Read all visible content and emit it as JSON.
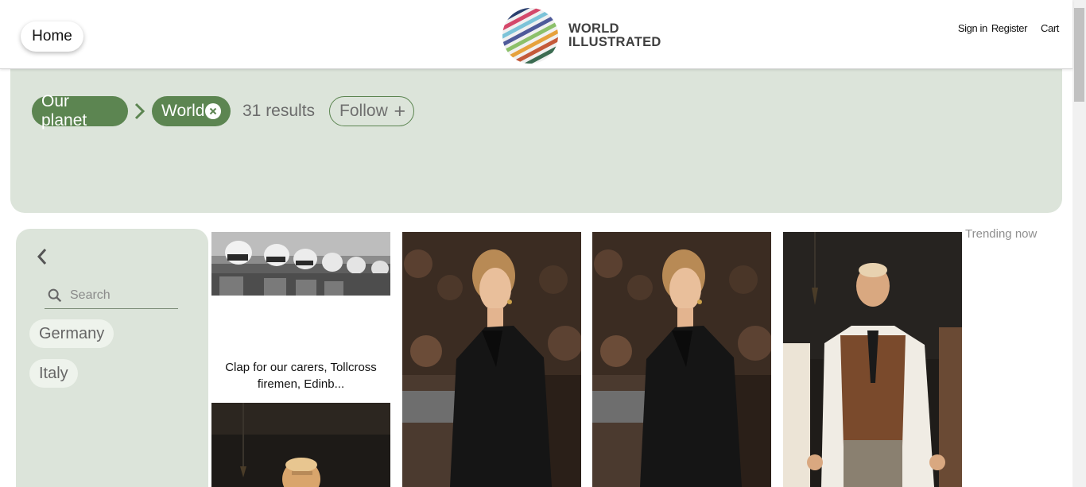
{
  "header": {
    "home_label": "Home",
    "logo_line1": "WORLD",
    "logo_line2": "ILLUSTRATED",
    "sign_in": "Sign in",
    "register": "Register",
    "cart": "Cart"
  },
  "filters": {
    "crumbs": [
      "Our planet",
      "World"
    ],
    "results": "31 results",
    "follow_label": "Follow"
  },
  "sidebar": {
    "search_placeholder": "Search",
    "tags": [
      "Germany",
      "Italy"
    ]
  },
  "grid": {
    "cards": [
      {
        "caption": "Clap for our carers, Tollcross firemen, Edinb..."
      }
    ],
    "trending_label": "Trending now"
  },
  "colors": {
    "accent_green": "#5c8551",
    "panel_bg": "#dce4da",
    "tag_bg": "#eef3ec"
  },
  "icons": [
    "chevron-right-icon",
    "close-circle-icon",
    "plus-icon",
    "chevron-left-icon",
    "search-icon",
    "globe-logo"
  ]
}
